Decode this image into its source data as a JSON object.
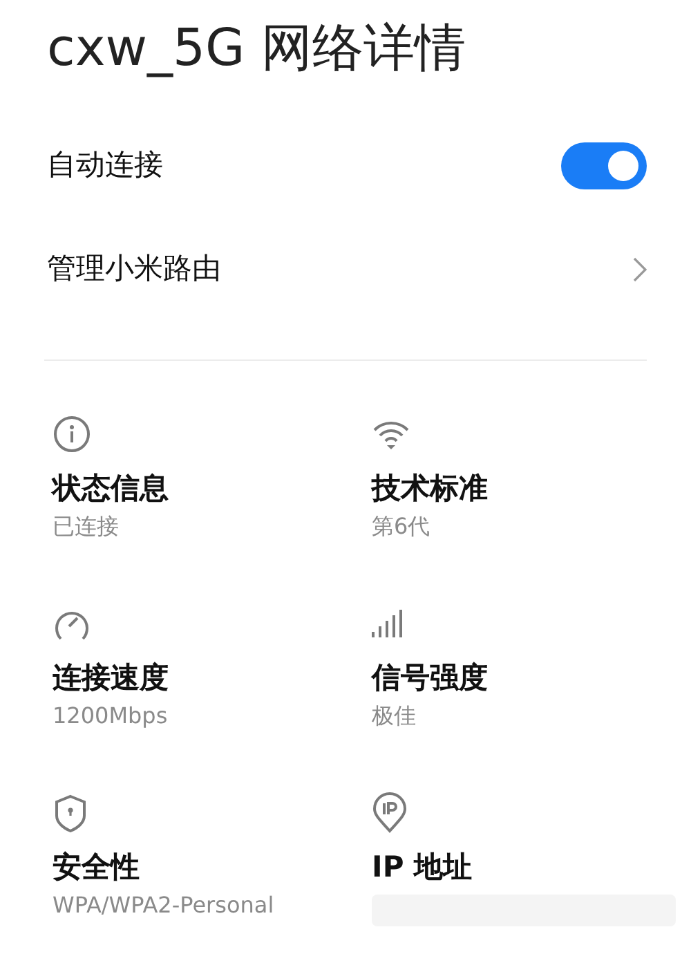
{
  "title": "cxw_5G 网络详情",
  "settings": [
    {
      "kind": "toggle",
      "label": "自动连接",
      "on": true
    },
    {
      "kind": "link",
      "label": "管理小米路由"
    }
  ],
  "details": [
    {
      "kind": "info",
      "label": "状态信息",
      "value": "已连接"
    },
    {
      "kind": "wifi",
      "label": "技术标准",
      "value": "第6代"
    },
    {
      "kind": "speed",
      "label": "连接速度",
      "value": "1200Mbps"
    },
    {
      "kind": "signal",
      "label": "信号强度",
      "value": "极佳"
    },
    {
      "kind": "shield",
      "label": "安全性",
      "value": "WPA/WPA2-Personal"
    },
    {
      "kind": "ip",
      "label": "IP 地址",
      "redacted": true
    }
  ]
}
